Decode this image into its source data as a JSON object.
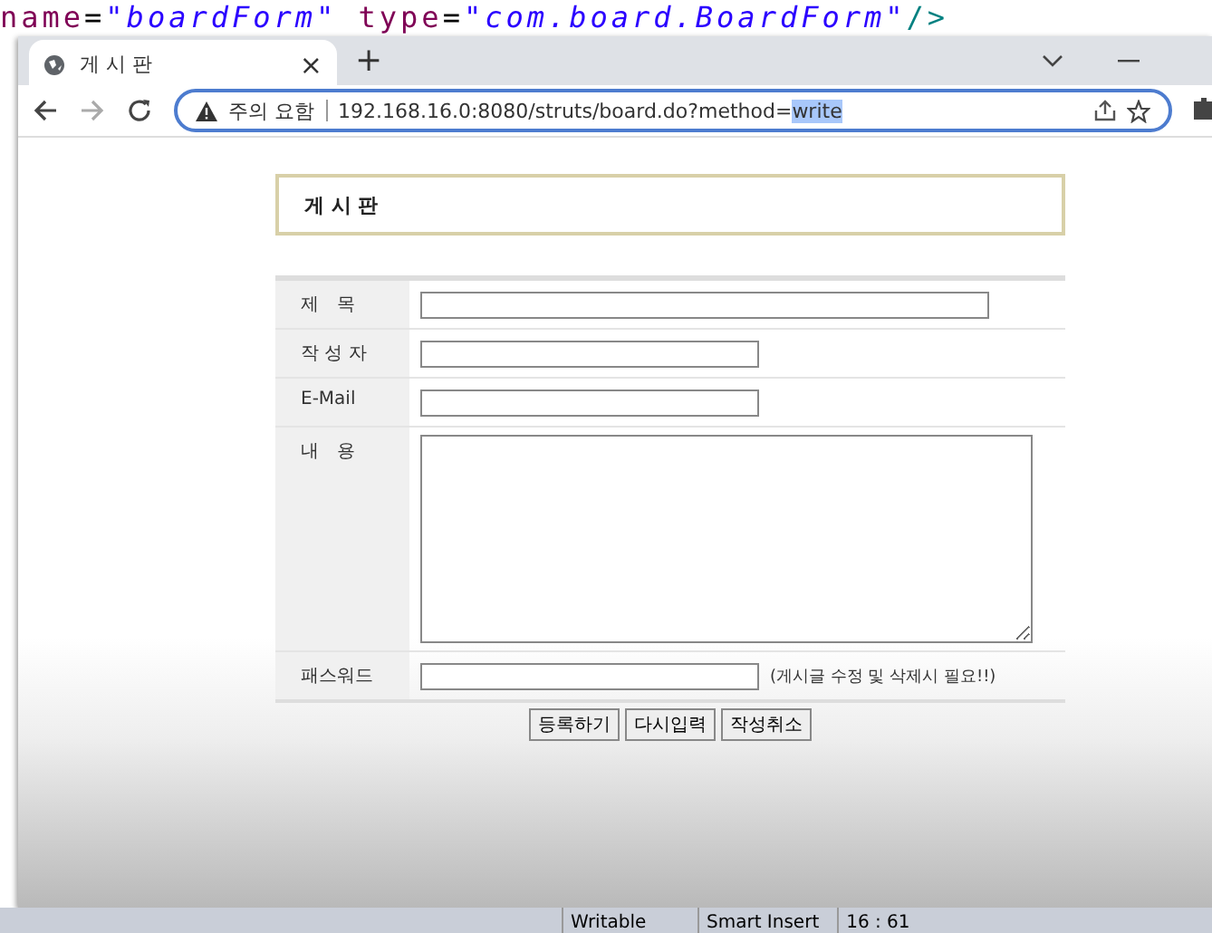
{
  "editor": {
    "code_line": [
      {
        "kind": "attr",
        "text": "name"
      },
      {
        "kind": "punct",
        "text": "="
      },
      {
        "kind": "string",
        "text": "\"boardForm\""
      },
      {
        "kind": "attr",
        "text": " type"
      },
      {
        "kind": "punct",
        "text": "="
      },
      {
        "kind": "string",
        "text": "\"com.board.BoardForm\""
      },
      {
        "kind": "tag",
        "text": "/>"
      }
    ],
    "status_bar": [
      "Writable",
      "Smart Insert",
      "16 : 61"
    ]
  },
  "browser": {
    "tab": {
      "title": "게 시 판",
      "close": "×"
    },
    "new_tab": "+",
    "address": {
      "warning": "주의 요함",
      "url": "192.168.16.0:8080/struts/board.do?method=",
      "url_selected": "write"
    }
  },
  "page": {
    "heading": "게 시 판",
    "fields": [
      {
        "label": "제　목",
        "kind": "long"
      },
      {
        "label": "작 성 자",
        "kind": "short"
      },
      {
        "label": "E-Mail",
        "kind": "short"
      },
      {
        "label": "내　용",
        "kind": "textarea"
      },
      {
        "label": "패스워드",
        "kind": "password",
        "note": "(게시글 수정 및 삭제시 필요!!)"
      }
    ],
    "buttons": [
      "등록하기",
      "다시입력",
      "작성취소"
    ]
  }
}
